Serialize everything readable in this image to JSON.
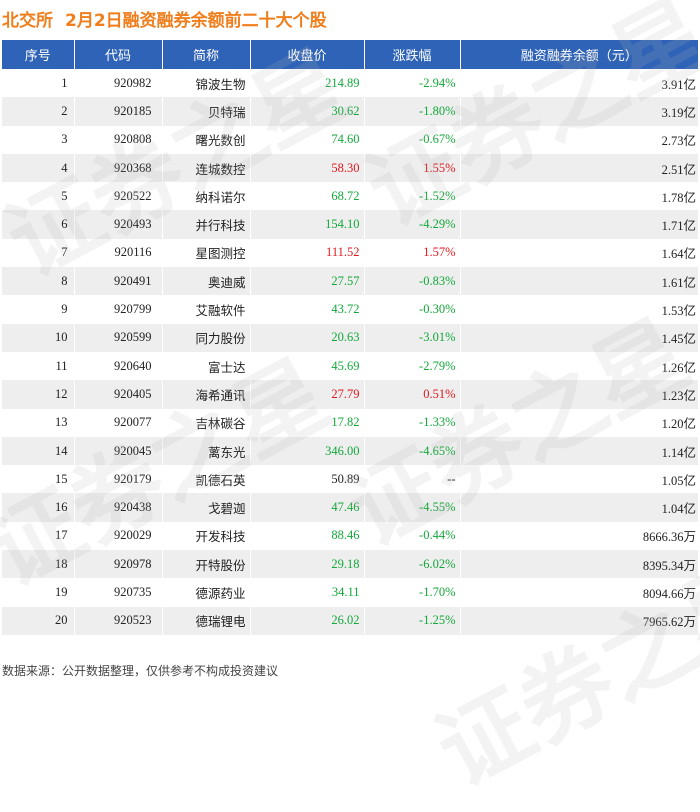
{
  "header": {
    "exchange": "北交所",
    "title": "2月2日融资融券余额前二十大个股"
  },
  "colors": {
    "accent": "#f07e1c",
    "header_bg": "#2f63b7",
    "up": "#e0191f",
    "down": "#13a83a"
  },
  "watermark_text": "证券之星",
  "chart_data": {
    "type": "table",
    "columns": [
      "序号",
      "代码",
      "简称",
      "收盘价",
      "涨跌幅",
      "融资融券余额（元）"
    ],
    "rows": [
      {
        "seq": "1",
        "code": "920982",
        "name": "锦波生物",
        "price": "214.89",
        "change": "-2.94%",
        "balance": "3.91",
        "unit": "亿",
        "dir": "down"
      },
      {
        "seq": "2",
        "code": "920185",
        "name": "贝特瑞",
        "price": "30.62",
        "change": "-1.80%",
        "balance": "3.19",
        "unit": "亿",
        "dir": "down"
      },
      {
        "seq": "3",
        "code": "920808",
        "name": "曙光数创",
        "price": "74.60",
        "change": "-0.67%",
        "balance": "2.73",
        "unit": "亿",
        "dir": "down"
      },
      {
        "seq": "4",
        "code": "920368",
        "name": "连城数控",
        "price": "58.30",
        "change": "1.55%",
        "balance": "2.51",
        "unit": "亿",
        "dir": "up"
      },
      {
        "seq": "5",
        "code": "920522",
        "name": "纳科诺尔",
        "price": "68.72",
        "change": "-1.52%",
        "balance": "1.78",
        "unit": "亿",
        "dir": "down"
      },
      {
        "seq": "6",
        "code": "920493",
        "name": "并行科技",
        "price": "154.10",
        "change": "-4.29%",
        "balance": "1.71",
        "unit": "亿",
        "dir": "down"
      },
      {
        "seq": "7",
        "code": "920116",
        "name": "星图测控",
        "price": "111.52",
        "change": "1.57%",
        "balance": "1.64",
        "unit": "亿",
        "dir": "up"
      },
      {
        "seq": "8",
        "code": "920491",
        "name": "奥迪威",
        "price": "27.57",
        "change": "-0.83%",
        "balance": "1.61",
        "unit": "亿",
        "dir": "down"
      },
      {
        "seq": "9",
        "code": "920799",
        "name": "艾融软件",
        "price": "43.72",
        "change": "-0.30%",
        "balance": "1.53",
        "unit": "亿",
        "dir": "down"
      },
      {
        "seq": "10",
        "code": "920599",
        "name": "同力股份",
        "price": "20.63",
        "change": "-3.01%",
        "balance": "1.45",
        "unit": "亿",
        "dir": "down"
      },
      {
        "seq": "11",
        "code": "920640",
        "name": "富士达",
        "price": "45.69",
        "change": "-2.79%",
        "balance": "1.26",
        "unit": "亿",
        "dir": "down"
      },
      {
        "seq": "12",
        "code": "920405",
        "name": "海希通讯",
        "price": "27.79",
        "change": "0.51%",
        "balance": "1.23",
        "unit": "亿",
        "dir": "up"
      },
      {
        "seq": "13",
        "code": "920077",
        "name": "吉林碳谷",
        "price": "17.82",
        "change": "-1.33%",
        "balance": "1.20",
        "unit": "亿",
        "dir": "down"
      },
      {
        "seq": "14",
        "code": "920045",
        "name": "蓠东光",
        "price": "346.00",
        "change": "-4.65%",
        "balance": "1.14",
        "unit": "亿",
        "dir": "down"
      },
      {
        "seq": "15",
        "code": "920179",
        "name": "凯德石英",
        "price": "50.89",
        "change": "--",
        "balance": "1.05",
        "unit": "亿",
        "dir": "flat"
      },
      {
        "seq": "16",
        "code": "920438",
        "name": "戈碧迦",
        "price": "47.46",
        "change": "-4.55%",
        "balance": "1.04",
        "unit": "亿",
        "dir": "down"
      },
      {
        "seq": "17",
        "code": "920029",
        "name": "开发科技",
        "price": "88.46",
        "change": "-0.44%",
        "balance": "8666.36",
        "unit": "万",
        "dir": "down"
      },
      {
        "seq": "18",
        "code": "920978",
        "name": "开特股份",
        "price": "29.18",
        "change": "-6.02%",
        "balance": "8395.34",
        "unit": "万",
        "dir": "down"
      },
      {
        "seq": "19",
        "code": "920735",
        "name": "德源药业",
        "price": "34.11",
        "change": "-1.70%",
        "balance": "8094.66",
        "unit": "万",
        "dir": "down"
      },
      {
        "seq": "20",
        "code": "920523",
        "name": "德瑞锂电",
        "price": "26.02",
        "change": "-1.25%",
        "balance": "7965.62",
        "unit": "万",
        "dir": "down"
      }
    ]
  },
  "footer": {
    "source": "数据来源：公开数据整理，仅供参考不构成投资建议"
  }
}
